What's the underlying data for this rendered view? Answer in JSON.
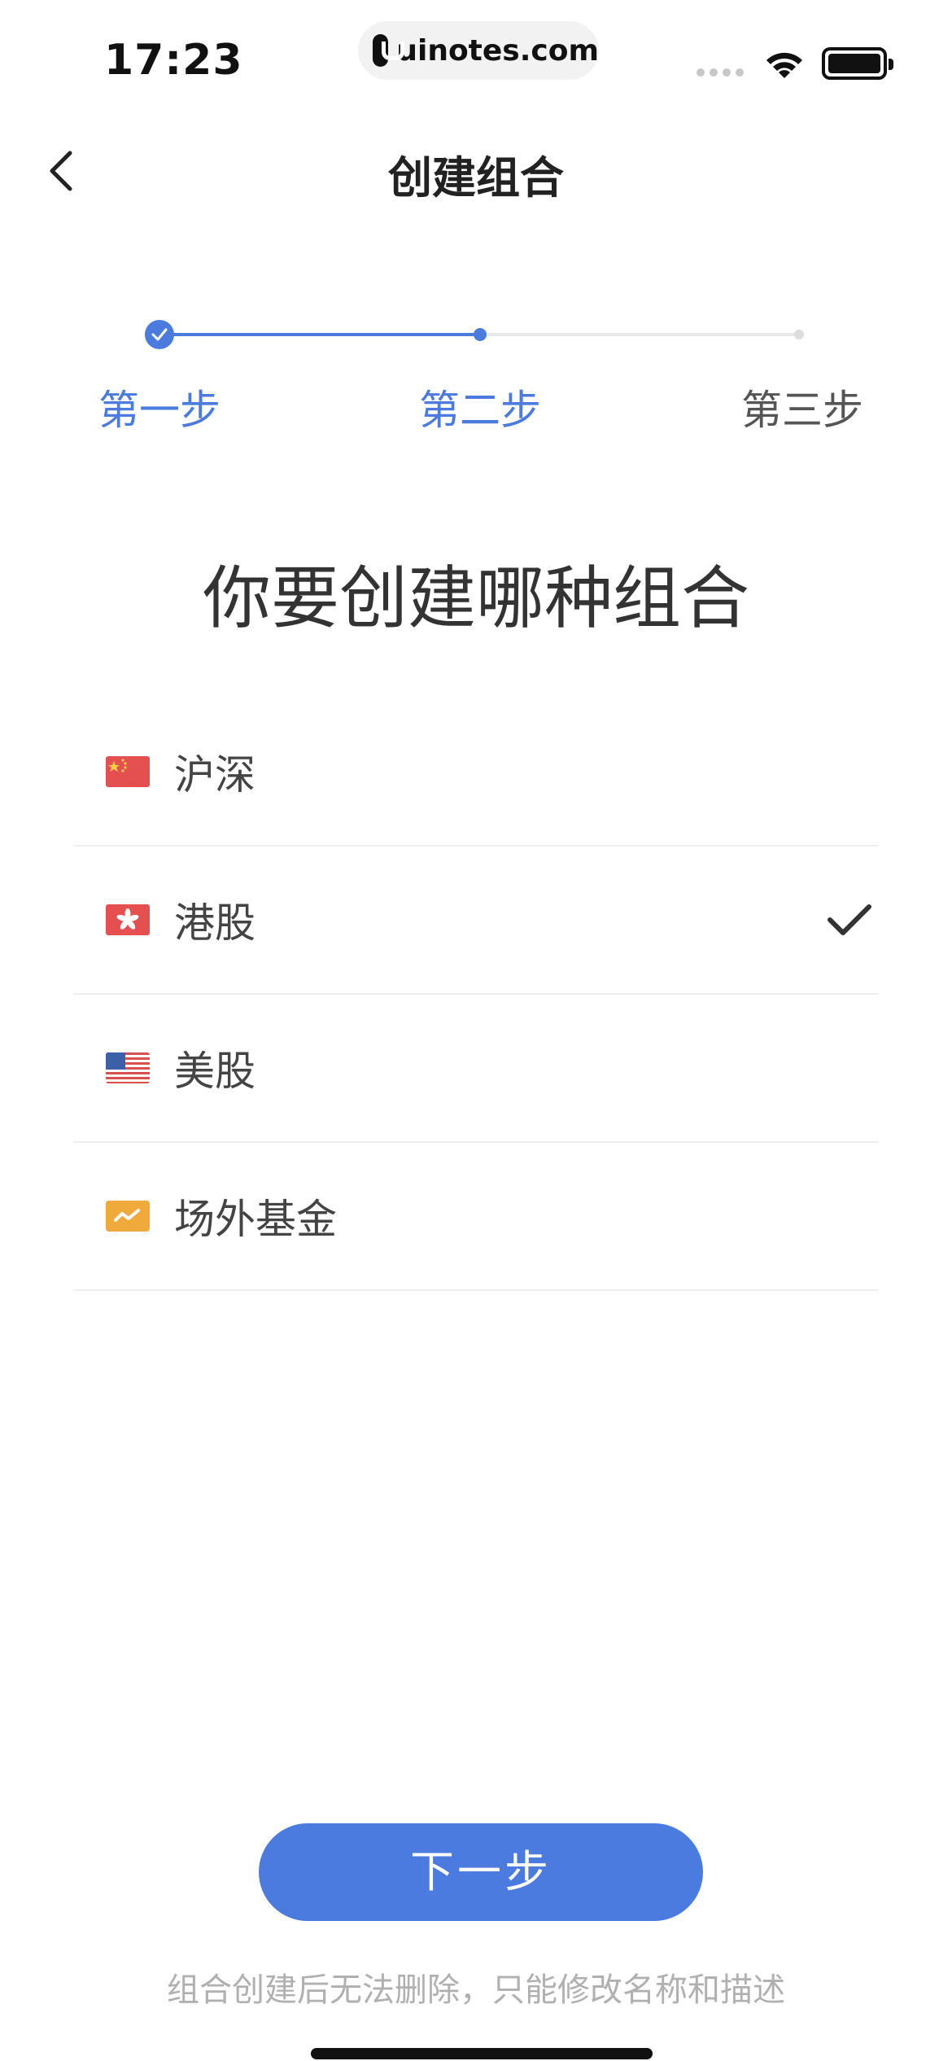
{
  "status_bar": {
    "time": "17:23",
    "url": "uinotes.com"
  },
  "nav": {
    "title": "创建组合"
  },
  "stepper": {
    "steps": [
      {
        "label": "第一步",
        "state": "done"
      },
      {
        "label": "第二步",
        "state": "current"
      },
      {
        "label": "第三步",
        "state": "todo"
      }
    ]
  },
  "heading": "你要创建哪种组合",
  "options": [
    {
      "label": "沪深",
      "icon": "cn-flag-icon",
      "selected": false
    },
    {
      "label": "港股",
      "icon": "hk-flag-icon",
      "selected": true
    },
    {
      "label": "美股",
      "icon": "us-flag-icon",
      "selected": false
    },
    {
      "label": "场外基金",
      "icon": "fund-icon",
      "selected": false
    }
  ],
  "next_button": "下一步",
  "footer_note": "组合创建后无法删除，只能修改名称和描述",
  "colors": {
    "accent": "#4b7bde",
    "text": "#333333",
    "muted": "#b0b0b0",
    "fund_icon": "#f0a93b",
    "flag_red": "#e4504f"
  }
}
